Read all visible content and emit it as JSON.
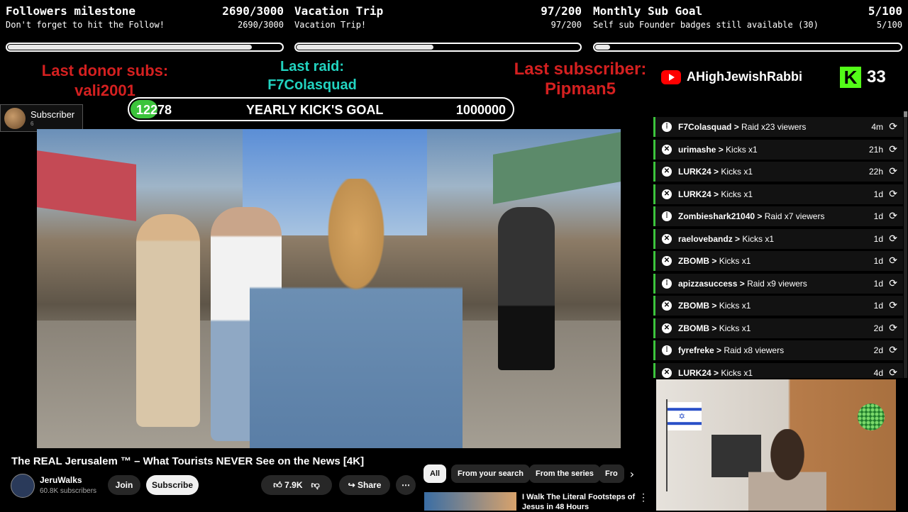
{
  "goals": [
    {
      "title": "Followers milestone",
      "value_title": "2690/3000",
      "subtitle": "Don't forget to hit the Follow!",
      "value_sub": "2690/3000",
      "progress": 0.897
    },
    {
      "title": "Vacation Trip",
      "value_title": "97/200",
      "subtitle": "Vacation Trip!",
      "value_sub": "97/200",
      "progress": 0.485
    },
    {
      "title": "Monthly Sub Goal",
      "value_title": "5/100",
      "subtitle": "Self sub Founder badges still available (30)",
      "value_sub": "5/100",
      "progress": 0.05
    }
  ],
  "alerts": {
    "last_donor_label": "Last donor subs:",
    "last_donor_name": "vali2001",
    "last_raid_label": "Last raid:",
    "last_raid_name": "F7Colasquad",
    "last_sub_label": "Last subscriber:",
    "last_sub_name": "Pipman5"
  },
  "yearly_goal": {
    "current": "12278",
    "label": "YEARLY KICK'S GOAL",
    "target": "1000000",
    "progress": 0.01228
  },
  "youtube_channel": {
    "name": "AHighJewishRabbi",
    "icon": "youtube-logo"
  },
  "kick": {
    "count": "33",
    "icon": "kick-logo"
  },
  "subscriber_box": {
    "label": "Subscriber",
    "count": "6"
  },
  "video": {
    "title": "The REAL Jerusalem ™ – What Tourists NEVER See on the News [4K]",
    "channel": "JeruWalks",
    "subscribers": "60.8K subscribers",
    "join_label": "Join",
    "subscribe_label": "Subscribe",
    "likes": "7.9K",
    "share_label": "Share"
  },
  "chips": [
    "All",
    "From your search",
    "From the series",
    "Fro"
  ],
  "recommendation": {
    "title": "I Walk The Literal Footsteps of Jesus in 48 Hours"
  },
  "feed": [
    {
      "user": "F7Colasquad",
      "action": "Raid x23 viewers",
      "time": "4m",
      "type": "raid"
    },
    {
      "user": "urimashe",
      "action": "Kicks x1",
      "time": "21h",
      "type": "kick"
    },
    {
      "user": "LURK24",
      "action": "Kicks x1",
      "time": "22h",
      "type": "kick"
    },
    {
      "user": "LURK24",
      "action": "Kicks x1",
      "time": "1d",
      "type": "kick"
    },
    {
      "user": "Zombieshark21040",
      "action": "Raid x7 viewers",
      "time": "1d",
      "type": "raid"
    },
    {
      "user": "raelovebandz",
      "action": "Kicks x1",
      "time": "1d",
      "type": "kick"
    },
    {
      "user": "ZBOMB",
      "action": "Kicks x1",
      "time": "1d",
      "type": "kick"
    },
    {
      "user": "apizzasuccess",
      "action": "Raid x9 viewers",
      "time": "1d",
      "type": "raid"
    },
    {
      "user": "ZBOMB",
      "action": "Kicks x1",
      "time": "1d",
      "type": "kick"
    },
    {
      "user": "ZBOMB",
      "action": "Kicks x1",
      "time": "2d",
      "type": "kick"
    },
    {
      "user": "fyrefreke",
      "action": "Raid x8 viewers",
      "time": "2d",
      "type": "raid"
    },
    {
      "user": "LURK24",
      "action": "Kicks x1",
      "time": "4d",
      "type": "kick"
    }
  ],
  "colors": {
    "donor": "#d42020",
    "raid": "#22d3c0",
    "kick_green": "#53fc18",
    "goal_green": "#3cc43c"
  }
}
